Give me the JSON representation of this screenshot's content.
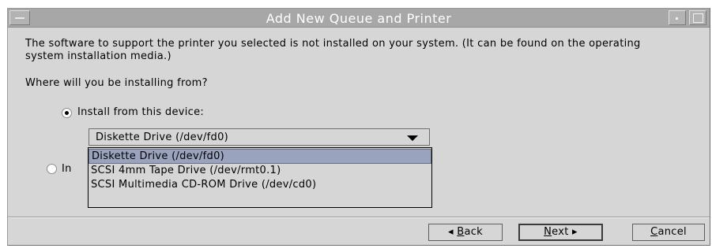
{
  "window": {
    "title": "Add New Queue and Printer"
  },
  "content": {
    "message": "The software to support the printer you selected is not installed on your system. (It can be found on the operating system installation media.)",
    "question": "Where will you be installing from?",
    "option_device_label": "Install from this device:",
    "option_other_label_visible": "In",
    "device_combo": {
      "selected": "Diskette Drive (/dev/fd0)",
      "options": [
        "Diskette Drive (/dev/fd0)",
        "SCSI 4mm Tape Drive (/dev/rmt0.1)",
        "SCSI Multimedia CD-ROM Drive (/dev/cd0)"
      ]
    }
  },
  "buttons": {
    "back_mnemonic": "B",
    "back_rest": "ack",
    "back_arrow": "◂",
    "next_mnemonic": "N",
    "next_rest": "ext",
    "next_arrow": "▸",
    "cancel_mnemonic": "C",
    "cancel_rest": "ancel"
  },
  "icons": {
    "window_menu": "window-menu-icon",
    "minimize": "minimize-icon",
    "maximize": "maximize-icon",
    "dropdown_arrow": "chevron-down-icon"
  }
}
